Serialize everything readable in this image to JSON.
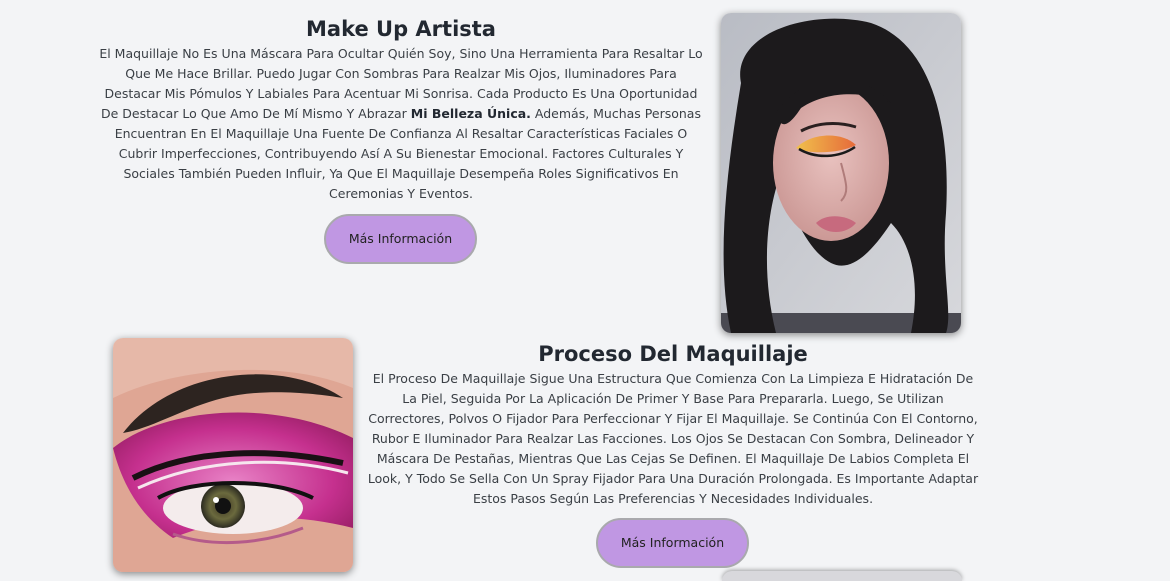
{
  "section1": {
    "title": "Make Up Artista",
    "para_part1": "El Maquillaje No Es Una Máscara Para Ocultar Quién Soy, Sino Una Herramienta Para Resaltar Lo Que Me Hace Brillar. Puedo Jugar Con Sombras Para Realzar Mis Ojos, Iluminadores Para Destacar Mis Pómulos Y Labiales Para Acentuar Mi Sonrisa. Cada Producto Es Una Oportunidad De Destacar Lo Que Amo De Mí Mismo Y Abrazar ",
    "para_bold": "Mi Belleza Única.",
    "para_part2": " Además, Muchas Personas Encuentran En El Maquillaje Una Fuente De Confianza Al Resaltar Características Faciales O Cubrir Imperfecciones, Contribuyendo Así A Su Bienestar Emocional. Factores Culturales Y Sociales También Pueden Influir, Ya Que El Maquillaje Desempeña Roles Significativos En Ceremonias Y Eventos.",
    "button_label": "Más Información"
  },
  "section2": {
    "title": "Proceso Del Maquillaje",
    "para": "El Proceso De Maquillaje Sigue Una Estructura Que Comienza Con La Limpieza E Hidratación De La Piel, Seguida Por La Aplicación De Primer Y Base Para Prepararla. Luego, Se Utilizan Correctores, Polvos O Fijador Para Perfeccionar Y Fijar El Maquillaje. Se Continúa Con El Contorno, Rubor E Iluminador Para Realzar Las Facciones. Los Ojos Se Destacan Con Sombra, Delineador Y Máscara De Pestañas, Mientras Que Las Cejas Se Definen. El Maquillaje De Labios Completa El Look, Y Todo Se Sella Con Un Spray Fijador Para Una Duración Prolongada. Es Importante Adaptar Estos Pasos Según Las Preferencias Y Necesidades Individuales.",
    "button_label": "Más Información"
  },
  "colors": {
    "background": "#f3f4f6",
    "button_fill": "#c097e3",
    "button_border": "#a9a9ad",
    "text": "#2a2e33"
  }
}
